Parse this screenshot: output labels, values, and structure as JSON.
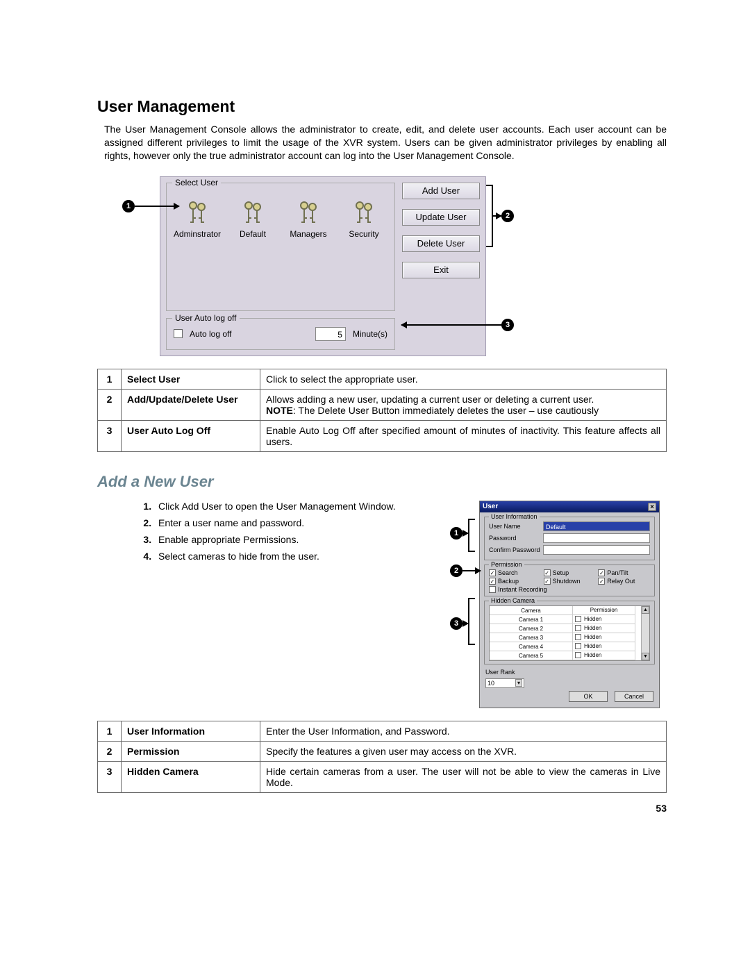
{
  "page_number": "53",
  "heading1": "User Management",
  "intro_paragraph": "The User Management Console allows the administrator to create, edit, and delete user accounts. Each user account can be assigned different privileges to limit the usage of the XVR system. Users can be given administrator privileges by enabling all rights, however only the true administrator account can log into the User Management Console.",
  "dlg1": {
    "fieldset_select_user": "Select User",
    "users": [
      "Adminstrator",
      "Default",
      "Managers",
      "Security"
    ],
    "fieldset_autologoff": "User Auto log off",
    "autologoff_label": "Auto log off",
    "autologoff_value": "5",
    "autologoff_unit": "Minute(s)",
    "buttons": {
      "add": "Add User",
      "update": "Update User",
      "delete": "Delete User",
      "exit": "Exit"
    }
  },
  "callouts1": {
    "c1": "1",
    "c2": "2",
    "c3": "3"
  },
  "table1": {
    "rows": [
      {
        "n": "1",
        "label": "Select User",
        "body": "Click to select the appropriate user."
      },
      {
        "n": "2",
        "label": "Add/Update/Delete User",
        "body_line1": "Allows adding a new user, updating a current user or deleting a current user.",
        "note_label": "NOTE",
        "note_body": ": The Delete User Button immediately deletes the user – use cautiously"
      },
      {
        "n": "3",
        "label": "User Auto Log Off",
        "body": "Enable Auto Log Off after specified amount of minutes of inactivity.  This feature affects all users."
      }
    ]
  },
  "heading2": "Add a New User",
  "steps": [
    "Click Add User to open the User Management Window.",
    "Enter a user name and password.",
    "Enable appropriate Permissions.",
    "Select cameras to hide from the user."
  ],
  "dlg2": {
    "title": "User",
    "section_userinfo": "User Information",
    "field_username": "User Name",
    "value_username": "Default",
    "field_password": "Password",
    "field_confirm": "Confirm Password",
    "section_permission": "Permission",
    "perm": {
      "search": "Search",
      "setup": "Setup",
      "pantilt": "Pan/Tilt",
      "backup": "Backup",
      "shutdown": "Shutdown",
      "relay": "Relay Out",
      "instant": "Instant Recording"
    },
    "section_hidden": "Hidden Camera",
    "cam_head": {
      "c1": "Camera",
      "c2": "Permission"
    },
    "cameras": [
      {
        "name": "Camera 1",
        "perm": "Hidden"
      },
      {
        "name": "Camera 2",
        "perm": "Hidden"
      },
      {
        "name": "Camera 3",
        "perm": "Hidden"
      },
      {
        "name": "Camera 4",
        "perm": "Hidden"
      },
      {
        "name": "Camera 5",
        "perm": "Hidden"
      }
    ],
    "section_rank": "User Rank",
    "rank_value": "10",
    "btn_ok": "OK",
    "btn_cancel": "Cancel"
  },
  "callouts2": {
    "c1": "1",
    "c2": "2",
    "c3": "3"
  },
  "table2": {
    "rows": [
      {
        "n": "1",
        "label": "User Information",
        "body": "Enter the User Information, and Password."
      },
      {
        "n": "2",
        "label": "Permission",
        "body": "Specify the features a given user may access on the XVR."
      },
      {
        "n": "3",
        "label": "Hidden Camera",
        "body": "Hide certain cameras from a user. The user will not be able to view the cameras in Live Mode."
      }
    ]
  }
}
